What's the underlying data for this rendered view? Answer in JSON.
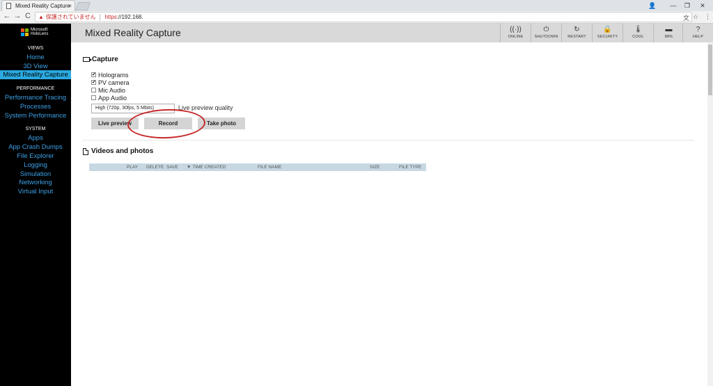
{
  "browser": {
    "tab_title": "Mixed Reality Capture",
    "tab_close": "×",
    "window_controls": [
      "👤",
      "—",
      "❐",
      "✕"
    ],
    "nav": {
      "back": "←",
      "forward": "→",
      "reload": "C"
    },
    "insecure_label": "保護されていません",
    "url_scheme": "https",
    "url_rest": "://192.168.",
    "right_icons": [
      "文",
      "☆",
      "⋮"
    ]
  },
  "sidebar": {
    "logo_line1": "Microsoft",
    "logo_line2": "HoloLens",
    "logo_colors": [
      "#f25022",
      "#7fba00",
      "#00a4ef",
      "#ffb900"
    ],
    "views_heading": "VIEWS",
    "views": [
      "Home",
      "3D View",
      "Mixed Reality Capture"
    ],
    "performance_heading": "PERFORMANCE",
    "performance": [
      "Performance Tracing",
      "Processes",
      "System Performance"
    ],
    "system_heading": "SYSTEM",
    "system": [
      "Apps",
      "App Crash Dumps",
      "File Explorer",
      "Logging",
      "Simulation",
      "Networking",
      "Virtual Input"
    ]
  },
  "header": {
    "title": "Mixed Reality Capture",
    "buttons": [
      {
        "icon": "((·))",
        "label": "ONLINE"
      },
      {
        "icon": "⏻",
        "label": "SHUTDOWN"
      },
      {
        "icon": "↻",
        "label": "RESTART"
      },
      {
        "icon": "🔒",
        "label": "SECURITY"
      },
      {
        "icon": "🌡",
        "label": "COOL"
      },
      {
        "icon": "▬",
        "label": "88%"
      },
      {
        "icon": "?",
        "label": "HELP"
      }
    ]
  },
  "capture": {
    "title": "Capture",
    "options": [
      {
        "label": "Holograms",
        "checked": "✔"
      },
      {
        "label": "PV camera",
        "checked": "✔"
      },
      {
        "label": "Mic Audio",
        "checked": ""
      },
      {
        "label": "App Audio",
        "checked": ""
      }
    ],
    "quality_value": "High (720p, 30fps, 5 Mbits)",
    "quality_label": "Live preview quality",
    "buttons": {
      "live_preview": "Live preview",
      "record": "Record",
      "take_photo": "Take photo"
    }
  },
  "videos": {
    "title": "Videos and photos",
    "columns": [
      "PLAY",
      "DELETE",
      "SAVE",
      "▼ TIME CREATED",
      "FILE NAME",
      "SIZE",
      "FILE TYPE"
    ]
  },
  "colors": {
    "accent": "#2aa9e0",
    "nav_link": "#3da1e6",
    "highlight_ring": "#c62828"
  }
}
